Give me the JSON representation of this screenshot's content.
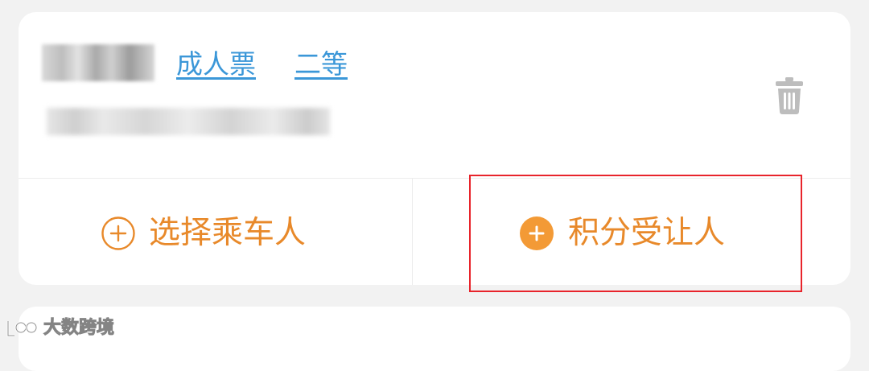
{
  "passenger": {
    "ticket_type": "成人票",
    "seat_class": "二等"
  },
  "actions": {
    "select_passenger": "选择乘车人",
    "points_recipient": "积分受让人"
  },
  "icons": {
    "delete": "trash-icon",
    "add_outline": "plus-circle-outline-icon",
    "add_filled": "plus-circle-filled-icon"
  },
  "watermark": {
    "text": "大数跨境"
  },
  "colors": {
    "accent_orange": "#e8892a",
    "link_blue": "#3b97d8",
    "highlight_red": "#e8242b",
    "page_background": "#f2f2f2",
    "card_background": "#ffffff",
    "icon_gray": "#bdbdbd"
  }
}
